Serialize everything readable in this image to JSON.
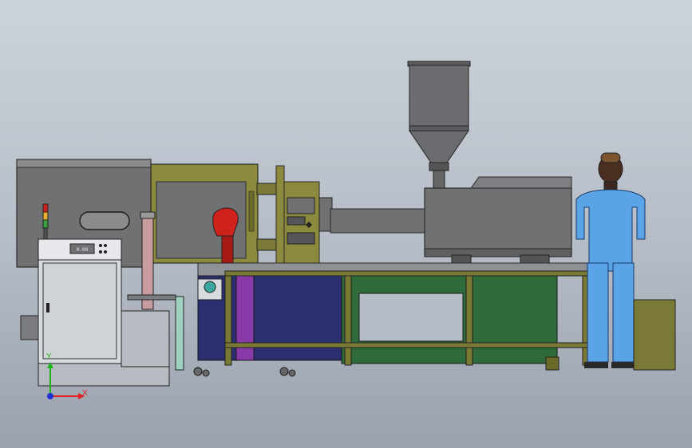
{
  "viewport": {
    "background_top": "#cdd3da",
    "background_bottom": "#9aa2ae"
  },
  "model": {
    "parts": [
      "injection-molding-machine",
      "hopper",
      "control-cabinet",
      "robot-arm",
      "conveyor",
      "operator-figure"
    ],
    "colors": {
      "machine_body": "#6f7072",
      "clamp_frame": "#8c8a3c",
      "frame_olive": "#7a7a36",
      "base_green": "#2f6b3a",
      "base_navy": "#2b2f6e",
      "robot_red": "#d0221c",
      "operator_blue": "#5aa3e6",
      "cabinet_light": "#d8dbe0"
    }
  },
  "control_panel": {
    "display_text": "0.00"
  },
  "triad": {
    "x_label": "X",
    "y_label": "Y",
    "x_color": "#e02020",
    "y_color": "#20b020",
    "z_color": "#2030d0"
  }
}
